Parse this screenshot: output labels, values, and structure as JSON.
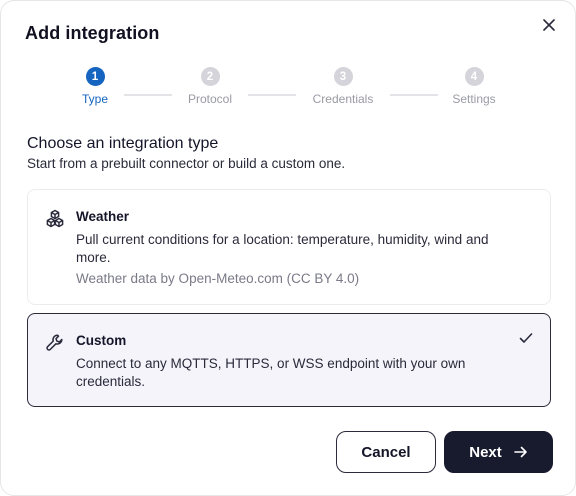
{
  "dialog": {
    "title": "Add integration",
    "close_icon": "close-icon"
  },
  "stepper": {
    "steps": [
      {
        "number": "1",
        "label": "Type",
        "active": true
      },
      {
        "number": "2",
        "label": "Protocol",
        "active": false
      },
      {
        "number": "3",
        "label": "Credentials",
        "active": false
      },
      {
        "number": "4",
        "label": "Settings",
        "active": false
      }
    ],
    "active_color": "#1565c0",
    "inactive_color": "#d4d4da"
  },
  "section": {
    "title": "Choose an integration type",
    "subtitle": "Start from a prebuilt connector or build a custom one."
  },
  "options": [
    {
      "icon": "cubes-icon",
      "title": "Weather",
      "description": "Pull current conditions for a location: temperature, humidity, wind and more.",
      "attribution": "Weather data by Open-Meteo.com (CC BY 4.0)",
      "selected": false
    },
    {
      "icon": "wrench-icon",
      "title": "Custom",
      "description": "Connect to any MQTTS, HTTPS, or WSS endpoint with your own credentials.",
      "selected": true
    }
  ],
  "footer": {
    "cancel_label": "Cancel",
    "next_label": "Next"
  }
}
